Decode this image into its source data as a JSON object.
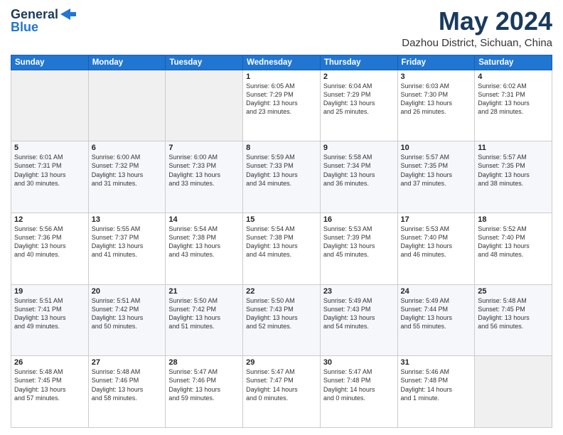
{
  "header": {
    "logo_general": "General",
    "logo_blue": "Blue",
    "month_title": "May 2024",
    "location": "Dazhou District, Sichuan, China"
  },
  "weekdays": [
    "Sunday",
    "Monday",
    "Tuesday",
    "Wednesday",
    "Thursday",
    "Friday",
    "Saturday"
  ],
  "weeks": [
    [
      {
        "day": "",
        "info": ""
      },
      {
        "day": "",
        "info": ""
      },
      {
        "day": "",
        "info": ""
      },
      {
        "day": "1",
        "info": "Sunrise: 6:05 AM\nSunset: 7:29 PM\nDaylight: 13 hours\nand 23 minutes."
      },
      {
        "day": "2",
        "info": "Sunrise: 6:04 AM\nSunset: 7:29 PM\nDaylight: 13 hours\nand 25 minutes."
      },
      {
        "day": "3",
        "info": "Sunrise: 6:03 AM\nSunset: 7:30 PM\nDaylight: 13 hours\nand 26 minutes."
      },
      {
        "day": "4",
        "info": "Sunrise: 6:02 AM\nSunset: 7:31 PM\nDaylight: 13 hours\nand 28 minutes."
      }
    ],
    [
      {
        "day": "5",
        "info": "Sunrise: 6:01 AM\nSunset: 7:31 PM\nDaylight: 13 hours\nand 30 minutes."
      },
      {
        "day": "6",
        "info": "Sunrise: 6:00 AM\nSunset: 7:32 PM\nDaylight: 13 hours\nand 31 minutes."
      },
      {
        "day": "7",
        "info": "Sunrise: 6:00 AM\nSunset: 7:33 PM\nDaylight: 13 hours\nand 33 minutes."
      },
      {
        "day": "8",
        "info": "Sunrise: 5:59 AM\nSunset: 7:33 PM\nDaylight: 13 hours\nand 34 minutes."
      },
      {
        "day": "9",
        "info": "Sunrise: 5:58 AM\nSunset: 7:34 PM\nDaylight: 13 hours\nand 36 minutes."
      },
      {
        "day": "10",
        "info": "Sunrise: 5:57 AM\nSunset: 7:35 PM\nDaylight: 13 hours\nand 37 minutes."
      },
      {
        "day": "11",
        "info": "Sunrise: 5:57 AM\nSunset: 7:35 PM\nDaylight: 13 hours\nand 38 minutes."
      }
    ],
    [
      {
        "day": "12",
        "info": "Sunrise: 5:56 AM\nSunset: 7:36 PM\nDaylight: 13 hours\nand 40 minutes."
      },
      {
        "day": "13",
        "info": "Sunrise: 5:55 AM\nSunset: 7:37 PM\nDaylight: 13 hours\nand 41 minutes."
      },
      {
        "day": "14",
        "info": "Sunrise: 5:54 AM\nSunset: 7:38 PM\nDaylight: 13 hours\nand 43 minutes."
      },
      {
        "day": "15",
        "info": "Sunrise: 5:54 AM\nSunset: 7:38 PM\nDaylight: 13 hours\nand 44 minutes."
      },
      {
        "day": "16",
        "info": "Sunrise: 5:53 AM\nSunset: 7:39 PM\nDaylight: 13 hours\nand 45 minutes."
      },
      {
        "day": "17",
        "info": "Sunrise: 5:53 AM\nSunset: 7:40 PM\nDaylight: 13 hours\nand 46 minutes."
      },
      {
        "day": "18",
        "info": "Sunrise: 5:52 AM\nSunset: 7:40 PM\nDaylight: 13 hours\nand 48 minutes."
      }
    ],
    [
      {
        "day": "19",
        "info": "Sunrise: 5:51 AM\nSunset: 7:41 PM\nDaylight: 13 hours\nand 49 minutes."
      },
      {
        "day": "20",
        "info": "Sunrise: 5:51 AM\nSunset: 7:42 PM\nDaylight: 13 hours\nand 50 minutes."
      },
      {
        "day": "21",
        "info": "Sunrise: 5:50 AM\nSunset: 7:42 PM\nDaylight: 13 hours\nand 51 minutes."
      },
      {
        "day": "22",
        "info": "Sunrise: 5:50 AM\nSunset: 7:43 PM\nDaylight: 13 hours\nand 52 minutes."
      },
      {
        "day": "23",
        "info": "Sunrise: 5:49 AM\nSunset: 7:43 PM\nDaylight: 13 hours\nand 54 minutes."
      },
      {
        "day": "24",
        "info": "Sunrise: 5:49 AM\nSunset: 7:44 PM\nDaylight: 13 hours\nand 55 minutes."
      },
      {
        "day": "25",
        "info": "Sunrise: 5:48 AM\nSunset: 7:45 PM\nDaylight: 13 hours\nand 56 minutes."
      }
    ],
    [
      {
        "day": "26",
        "info": "Sunrise: 5:48 AM\nSunset: 7:45 PM\nDaylight: 13 hours\nand 57 minutes."
      },
      {
        "day": "27",
        "info": "Sunrise: 5:48 AM\nSunset: 7:46 PM\nDaylight: 13 hours\nand 58 minutes."
      },
      {
        "day": "28",
        "info": "Sunrise: 5:47 AM\nSunset: 7:46 PM\nDaylight: 13 hours\nand 59 minutes."
      },
      {
        "day": "29",
        "info": "Sunrise: 5:47 AM\nSunset: 7:47 PM\nDaylight: 14 hours\nand 0 minutes."
      },
      {
        "day": "30",
        "info": "Sunrise: 5:47 AM\nSunset: 7:48 PM\nDaylight: 14 hours\nand 0 minutes."
      },
      {
        "day": "31",
        "info": "Sunrise: 5:46 AM\nSunset: 7:48 PM\nDaylight: 14 hours\nand 1 minute."
      },
      {
        "day": "",
        "info": ""
      }
    ]
  ]
}
